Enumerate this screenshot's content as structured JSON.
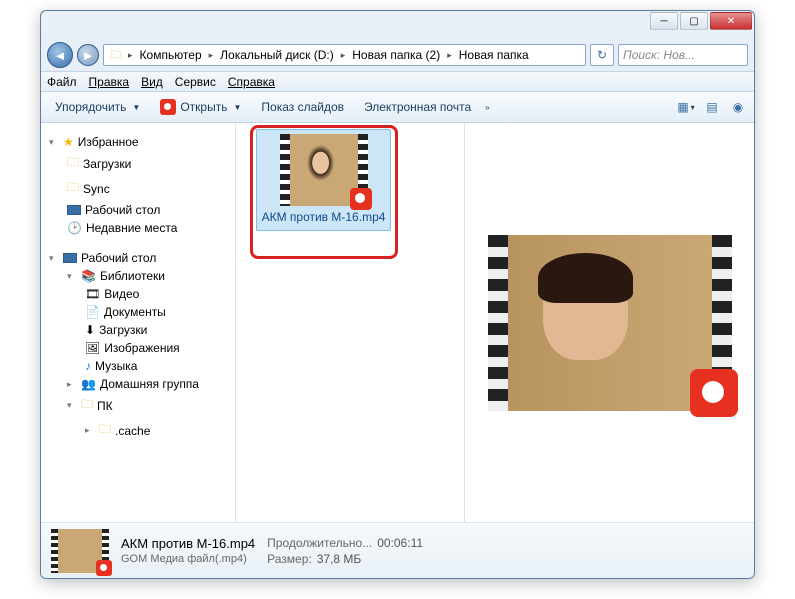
{
  "breadcrumb": {
    "root": "Компьютер",
    "parts": [
      "Локальный диск (D:)",
      "Новая папка (2)",
      "Новая папка"
    ]
  },
  "search": {
    "placeholder": "Поиск: Нов..."
  },
  "menu": {
    "file": "Файл",
    "edit": "Правка",
    "view": "Вид",
    "tools": "Сервис",
    "help": "Справка"
  },
  "cmd": {
    "organize": "Упорядочить",
    "open": "Открыть",
    "slideshow": "Показ слайдов",
    "email": "Электронная почта"
  },
  "sidebar": {
    "favorites": {
      "label": "Избранное",
      "items": [
        "Загрузки",
        "Sync",
        "Рабочий стол",
        "Недавние места"
      ]
    },
    "desktop": {
      "label": "Рабочий стол",
      "libraries": {
        "label": "Библиотеки",
        "items": [
          "Видео",
          "Документы",
          "Загрузки",
          "Изображения",
          "Музыка"
        ]
      },
      "homegroup": "Домашняя группа",
      "pc": "ПК",
      "cache": ".cache"
    }
  },
  "file": {
    "name": "АКМ против М-16.mp4"
  },
  "details": {
    "name": "АКМ против М-16.mp4",
    "type": "GOM Медиа файл(.mp4)",
    "duration_lbl": "Продолжительно...",
    "duration_val": "00:06:11",
    "size_lbl": "Размер:",
    "size_val": "37,8 МБ"
  }
}
